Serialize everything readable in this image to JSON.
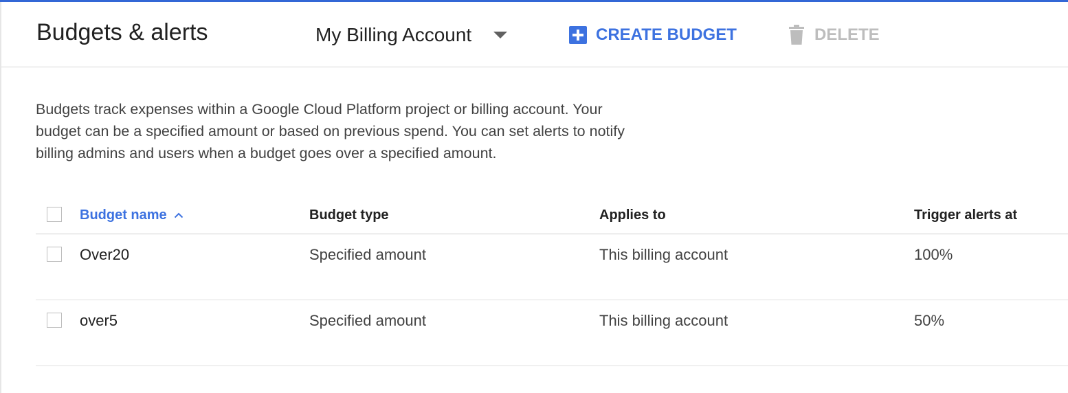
{
  "header": {
    "title": "Budgets & alerts",
    "account_selector": "My Billing Account",
    "create_label": "CREATE BUDGET",
    "delete_label": "DELETE"
  },
  "description": "Budgets track expenses within a Google Cloud Platform project or billing account. Your budget can be a specified amount or based on previous spend. You can set alerts to notify billing admins and users when a budget goes over a specified amount.",
  "table": {
    "columns": {
      "name": "Budget name",
      "type": "Budget type",
      "applies": "Applies to",
      "trigger": "Trigger alerts at"
    },
    "sort": {
      "column": "name",
      "direction": "ascending"
    },
    "rows": [
      {
        "name": "Over20",
        "type": "Specified amount",
        "applies": "This billing account",
        "trigger": "100%"
      },
      {
        "name": "over5",
        "type": "Specified amount",
        "applies": "This billing account",
        "trigger": "50%"
      }
    ]
  },
  "colors": {
    "accent": "#3d72e0",
    "top_bar": "#3367d6",
    "disabled": "#bdbdbd"
  },
  "icons": {
    "create": "plus-box-icon",
    "delete": "trash-icon",
    "dropdown": "caret-down-icon",
    "sort": "chevron-up-icon"
  }
}
